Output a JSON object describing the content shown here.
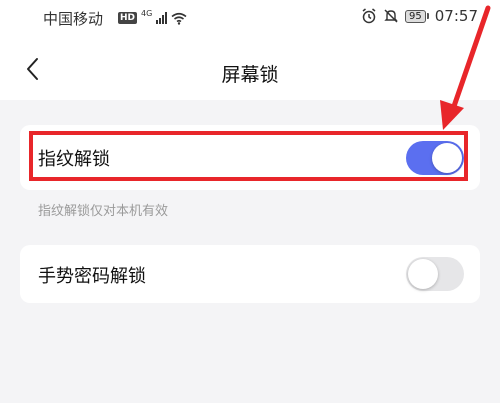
{
  "status_bar": {
    "carrier": "中国移动",
    "hd_badge": "HD",
    "network": "4G",
    "battery_level": "95",
    "time": "07:57"
  },
  "header": {
    "title": "屏幕锁",
    "back_icon": "chevron-left-icon"
  },
  "settings": {
    "fingerprint": {
      "label": "指纹解锁",
      "enabled": true,
      "hint": "指纹解锁仅对本机有效"
    },
    "gesture": {
      "label": "手势密码解锁",
      "enabled": false
    }
  },
  "colors": {
    "toggle_on": "#5b6ff0",
    "toggle_off": "#e6e6e8",
    "annotation": "#e8262a",
    "background": "#f4f4f6"
  }
}
